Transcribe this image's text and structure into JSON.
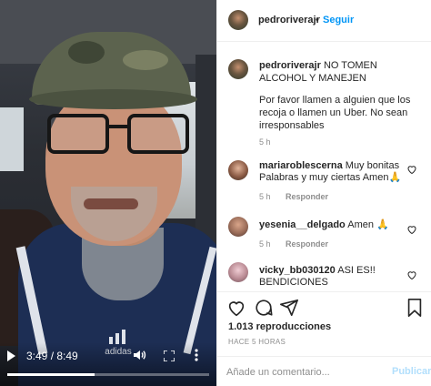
{
  "video": {
    "time_label": "3:49 / 8:49",
    "progress": 0.433,
    "logo_text": "adidas"
  },
  "header": {
    "username": "pedroriverajr",
    "separator": "•",
    "follow_label": "Seguir"
  },
  "caption": {
    "username": "pedroriverajr",
    "title": "NO TOMEN ALCOHOL Y MANEJEN",
    "body": "Por favor llamen a alguien que los recoja o llamen un Uber. No sean irresponsables",
    "time": "5 h"
  },
  "comments": [
    {
      "username": "mariaroblescerna",
      "text": "Muy bonitas Palabras y muy ciertas Amen🙏",
      "time": "5 h",
      "reply_label": "Responder"
    },
    {
      "username": "yesenia__delgado",
      "text": "Amen 🙏",
      "time": "5 h",
      "reply_label": "Responder"
    },
    {
      "username": "vicky_bb030120",
      "text": "ASI ES!! BENDICIONES",
      "time": "",
      "reply_label": ""
    }
  ],
  "actions": {
    "icons": [
      "heart-icon",
      "comment-icon",
      "share-icon",
      "save-icon"
    ],
    "views": "1.013 reproducciones",
    "ago": "HACE 5 HORAS"
  },
  "add_comment": {
    "placeholder": "Añade un comentario...",
    "publish_label": "Publicar"
  },
  "colors": {
    "accent": "#0095f6",
    "publish_disabled": "#b2dffc",
    "meta_gray": "#8e8e8e"
  }
}
